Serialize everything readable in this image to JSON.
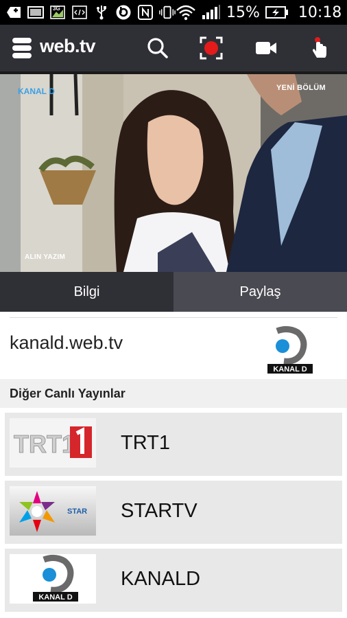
{
  "status_bar": {
    "battery_percent": "15%",
    "time": "10:18",
    "network_label": "3G"
  },
  "app_bar": {
    "brand": "web.tv",
    "icons": [
      "menu-icon",
      "search-icon",
      "record-icon",
      "video-camera-icon",
      "touch-icon"
    ],
    "accent_color": "#e31b1b",
    "bar_color": "#2f2f36"
  },
  "video": {
    "channel_watermark": "KANAL D",
    "badge": "YENİ BÖLÜM",
    "caption": "ALIN YAZIM"
  },
  "tabs": [
    {
      "label": "Bilgi",
      "active": true
    },
    {
      "label": "Paylaş",
      "active": false
    }
  ],
  "info": {
    "site_name": "kanald.web.tv",
    "logo_text": "KANAL D"
  },
  "section": {
    "title": "Diğer Canlı Yayınlar"
  },
  "channels": [
    {
      "name": "TRT1",
      "logo_text": "TRT1"
    },
    {
      "name": "STARTV",
      "logo_text": "STAR"
    },
    {
      "name": "KANALD",
      "logo_text": "KANAL D"
    }
  ]
}
